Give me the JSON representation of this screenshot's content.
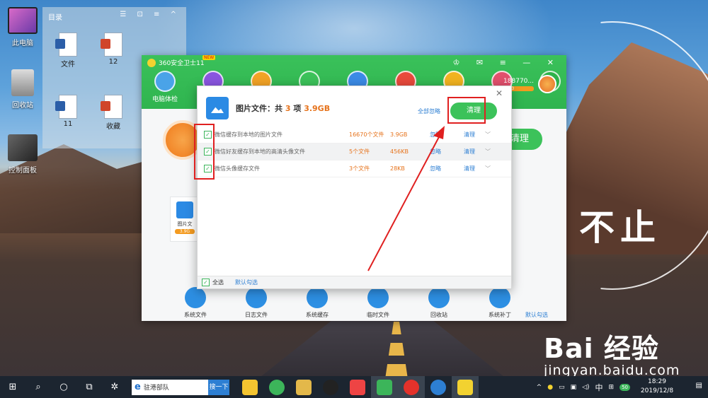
{
  "desktop": {
    "icons": [
      {
        "label": "此电脑"
      },
      {
        "label": "回收站"
      },
      {
        "label": "控制面板"
      }
    ],
    "watermark": {
      "logo": "Bai 经验",
      "url": "jingyan.baidu.com"
    },
    "wallpaper_text": "不止"
  },
  "explorer": {
    "title": "目录",
    "files": [
      {
        "label": "文件",
        "type": "word"
      },
      {
        "label": "12",
        "type": "ppt"
      },
      {
        "label": "11",
        "type": "word"
      },
      {
        "label": "收藏",
        "type": "ppt"
      }
    ]
  },
  "app": {
    "title": "360安全卫士11",
    "new_badge": "NEW",
    "nav": [
      {
        "label": "电脑体检",
        "icon": "monitor-icon"
      },
      {
        "label": "",
        "icon": "trojan-icon"
      },
      {
        "label": "",
        "icon": "computer-clean-icon"
      },
      {
        "label": "",
        "icon": "shield-icon"
      },
      {
        "label": "",
        "icon": "rocket-icon"
      },
      {
        "label": "",
        "icon": "apps-icon"
      },
      {
        "label": "",
        "icon": "money-icon"
      },
      {
        "label": "",
        "icon": "puzzle-icon"
      },
      {
        "label": "",
        "icon": "game-icon"
      }
    ],
    "user": {
      "name": "188770...",
      "level": "Lv.3"
    },
    "main_clean_label": "清理",
    "image_item": {
      "label": "图片文",
      "size": "3.9G"
    },
    "bottom_items": [
      {
        "label": "系统文件"
      },
      {
        "label": "日志文件"
      },
      {
        "label": "系统缓存"
      },
      {
        "label": "临时文件"
      },
      {
        "label": "回收站"
      },
      {
        "label": "系统补丁"
      }
    ],
    "default_check": "默认勾选"
  },
  "dialog": {
    "title_prefix": "图片文件：共",
    "count": "3",
    "title_mid": "项",
    "total_size": "3.9GB",
    "ignore_all": "全部忽略",
    "clean_button": "清理",
    "rows": [
      {
        "name": "微信缓存到本地的图片文件",
        "count": "16670个文件",
        "size": "3.9GB",
        "ignore": "忽略",
        "clean": "清理",
        "checked": true
      },
      {
        "name": "微信好友缓存到本地的高清头像文件",
        "count": "5个文件",
        "size": "456KB",
        "ignore": "忽略",
        "clean": "清理",
        "checked": true
      },
      {
        "name": "微信头像缓存文件",
        "count": "3个文件",
        "size": "28KB",
        "ignore": "忽略",
        "clean": "清理",
        "checked": true
      }
    ],
    "select_all": "全选",
    "default_check": "默认勾选"
  },
  "taskbar": {
    "search_text": "驻港部队",
    "search_button": "搜一下",
    "ime": "中",
    "network_badge": "50",
    "time": "18:29",
    "date": "2019/12/8"
  },
  "colors": {
    "brand_green": "#3cc25a",
    "annotation_red": "#e02020",
    "link_blue": "#2d7fd3",
    "accent_orange": "#e6731c"
  }
}
